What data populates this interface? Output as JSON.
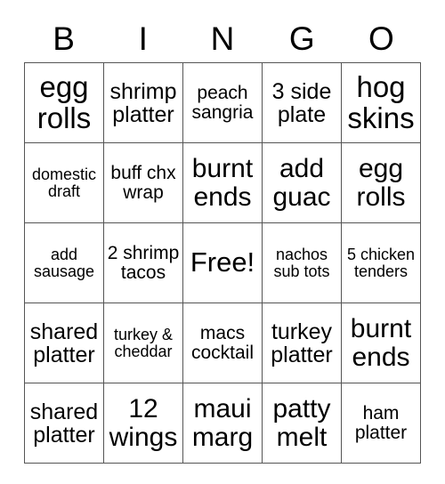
{
  "card": {
    "header_letters": [
      "B",
      "I",
      "N",
      "G",
      "O"
    ],
    "columns": 5,
    "rows": 5,
    "free_space_label": "Free!",
    "free_space_position": {
      "row": 3,
      "column": 3
    },
    "grid": [
      [
        {
          "text": "egg rolls",
          "size": "fs-xl"
        },
        {
          "text": "shrimp platter",
          "size": "fs-md"
        },
        {
          "text": "peach sangria",
          "size": "fs-sm"
        },
        {
          "text": "3 side plate",
          "size": "fs-md"
        },
        {
          "text": "hog skins",
          "size": "fs-xl"
        }
      ],
      [
        {
          "text": "domestic draft",
          "size": "fs-xs"
        },
        {
          "text": "buff chx wrap",
          "size": "fs-sm"
        },
        {
          "text": "burnt ends",
          "size": "fs-lg"
        },
        {
          "text": "add guac",
          "size": "fs-lg"
        },
        {
          "text": "egg rolls",
          "size": "fs-lg"
        }
      ],
      [
        {
          "text": "add sausage",
          "size": "fs-xs"
        },
        {
          "text": "2 shrimp tacos",
          "size": "fs-sm"
        },
        {
          "text": "Free!",
          "size": "fs-free"
        },
        {
          "text": "nachos sub tots",
          "size": "fs-xs"
        },
        {
          "text": "5 chicken tenders",
          "size": "fs-xs"
        }
      ],
      [
        {
          "text": "shared platter",
          "size": "fs-md"
        },
        {
          "text": "turkey & cheddar",
          "size": "fs-xs"
        },
        {
          "text": "macs cocktail",
          "size": "fs-sm"
        },
        {
          "text": "turkey platter",
          "size": "fs-md"
        },
        {
          "text": "burnt ends",
          "size": "fs-lg"
        }
      ],
      [
        {
          "text": "shared platter",
          "size": "fs-md"
        },
        {
          "text": "12 wings",
          "size": "fs-lg"
        },
        {
          "text": "maui marg",
          "size": "fs-lg"
        },
        {
          "text": "patty melt",
          "size": "fs-lg"
        },
        {
          "text": "ham platter",
          "size": "fs-sm"
        }
      ]
    ]
  },
  "style": {
    "border_color": "#555555",
    "background_color": "#ffffff",
    "text_color": "#000000"
  }
}
